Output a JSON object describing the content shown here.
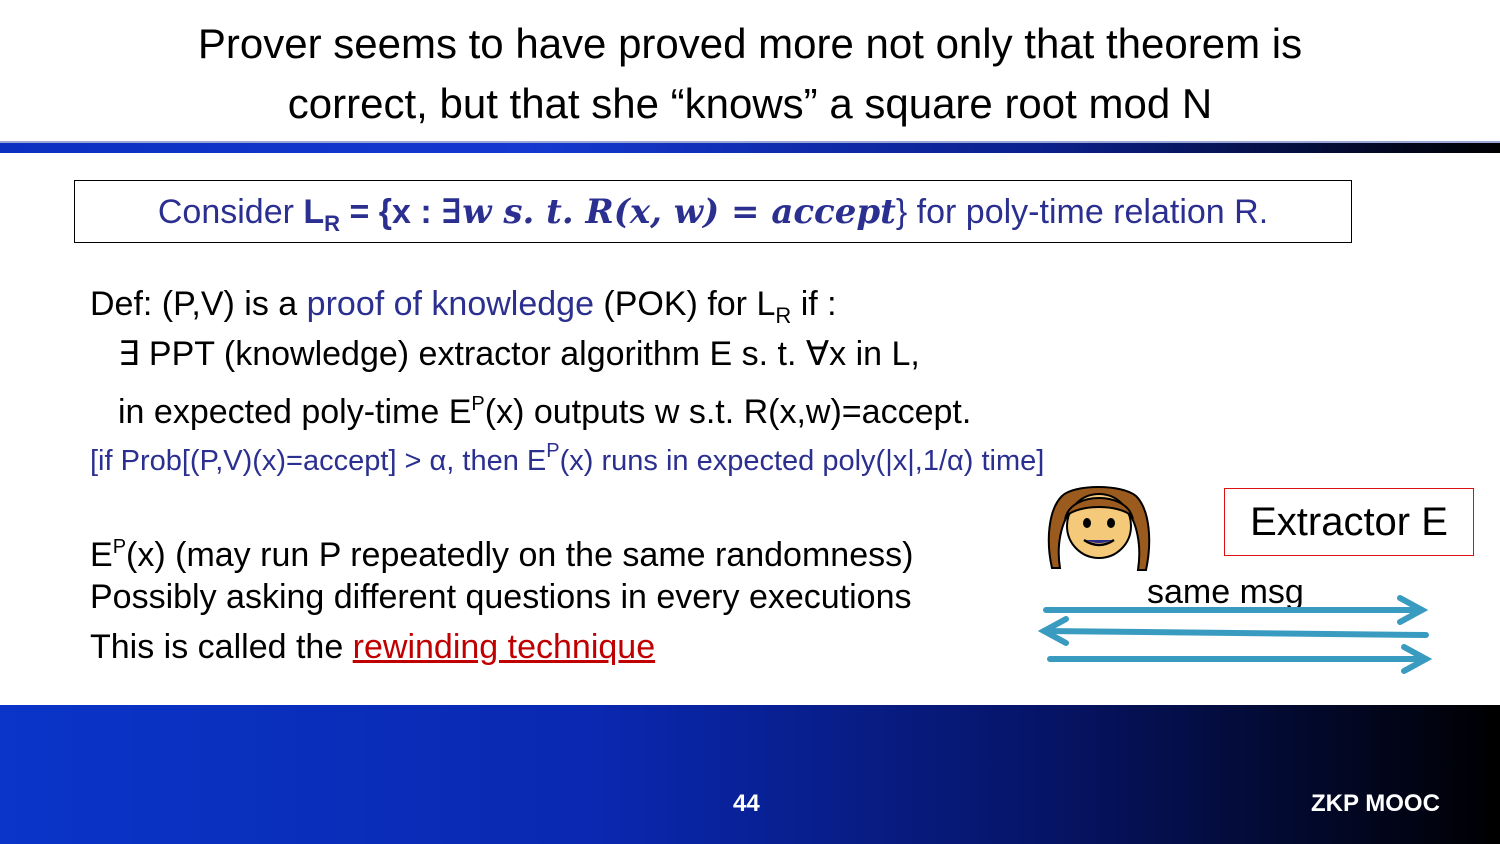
{
  "title": {
    "line1": "Prover seems to have proved more not only that theorem is",
    "line2": "correct, but that she “knows” a square root mod N"
  },
  "definition_box": {
    "prefix": "Consider ",
    "L": "L",
    "L_sub": "R",
    "set_open": " = {x : ",
    "formula": "∃𝒘 𝒔. 𝒕. 𝑹(𝒙, 𝒘) = 𝒂𝒄𝒄𝒆𝒑𝒕",
    "set_close": "}",
    "suffix": " for poly-time relation R."
  },
  "def": {
    "line1_a": "Def: (P,V) is a ",
    "line1_link": "proof of knowledge",
    "line1_b": " (POK) for L",
    "line1_sub": "R",
    "line1_c": "  if :",
    "line2": "∃  PPT (knowledge) extractor algorithm E s. t. ∀x in L,",
    "line3_a": "in expected poly-time E",
    "line3_sup": "P",
    "line3_b": "(x) outputs w s.t. R(x,w)=accept.",
    "line4_a": "[if Prob[(P,V)(x)=accept] > α, then E",
    "line4_sup": "P",
    "line4_b": "(x) runs in expected poly(|x|,1/α) time]"
  },
  "rewind": {
    "line1_a": "E",
    "line1_sup": "P",
    "line1_b": "(x) (may run P repeatedly on the same randomness)",
    "line2": "Possibly asking different questions in every executions",
    "line3_a": "This is called the ",
    "line3_link": "rewinding technique"
  },
  "diagram": {
    "extractor_label": "Extractor E",
    "same_msg_label": "same msg",
    "arrow_color": "#3a9bc1",
    "prover_icon": "girl-face-icon"
  },
  "footer": {
    "page_number": "44",
    "course": "ZKP MOOC"
  },
  "colors": {
    "accent_blue": "#2b3090",
    "link_red": "#c00000",
    "footer_blue": "#0a35c8"
  }
}
